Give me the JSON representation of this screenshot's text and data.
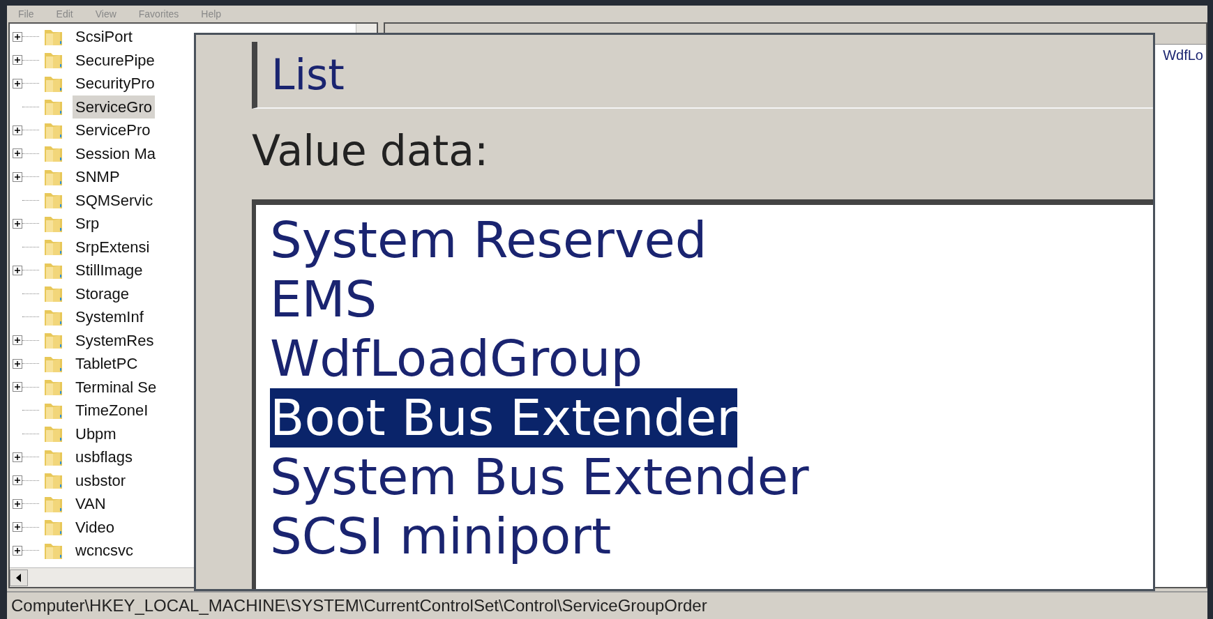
{
  "menu": [
    "File",
    "Edit",
    "View",
    "Favorites",
    "Help"
  ],
  "tree": [
    {
      "label": "ScsiPort",
      "expandable": true,
      "selected": false
    },
    {
      "label": "SecurePipe",
      "expandable": true,
      "selected": false
    },
    {
      "label": "SecurityPro",
      "expandable": true,
      "selected": false
    },
    {
      "label": "ServiceGro",
      "expandable": false,
      "selected": true
    },
    {
      "label": "ServicePro",
      "expandable": true,
      "selected": false
    },
    {
      "label": "Session Ma",
      "expandable": true,
      "selected": false
    },
    {
      "label": "SNMP",
      "expandable": true,
      "selected": false
    },
    {
      "label": "SQMServic",
      "expandable": false,
      "selected": false
    },
    {
      "label": "Srp",
      "expandable": true,
      "selected": false
    },
    {
      "label": "SrpExtensi",
      "expandable": false,
      "selected": false
    },
    {
      "label": "StillImage",
      "expandable": true,
      "selected": false
    },
    {
      "label": "Storage",
      "expandable": false,
      "selected": false
    },
    {
      "label": "SystemInf",
      "expandable": false,
      "selected": false
    },
    {
      "label": "SystemRes",
      "expandable": true,
      "selected": false
    },
    {
      "label": "TabletPC",
      "expandable": true,
      "selected": false
    },
    {
      "label": "Terminal Se",
      "expandable": true,
      "selected": false
    },
    {
      "label": "TimeZoneI",
      "expandable": false,
      "selected": false
    },
    {
      "label": "Ubpm",
      "expandable": false,
      "selected": false
    },
    {
      "label": "usbflags",
      "expandable": true,
      "selected": false
    },
    {
      "label": "usbstor",
      "expandable": true,
      "selected": false
    },
    {
      "label": "VAN",
      "expandable": true,
      "selected": false
    },
    {
      "label": "Video",
      "expandable": true,
      "selected": false
    },
    {
      "label": "wcncsvc",
      "expandable": true,
      "selected": false
    }
  ],
  "values_pane": {
    "rows": [
      {
        "data": "WdfLo"
      }
    ]
  },
  "dialog": {
    "value_name": "List",
    "value_data_label": "Value data:",
    "value_data_lines": [
      {
        "text": "System Reserved",
        "selected": false
      },
      {
        "text": "EMS",
        "selected": false
      },
      {
        "text": "WdfLoadGroup",
        "selected": false
      },
      {
        "text": "Boot Bus Extender",
        "selected": true
      },
      {
        "text": "System Bus Extender",
        "selected": false
      },
      {
        "text": "SCSI miniport",
        "selected": false
      }
    ]
  },
  "status_bar": "Computer\\HKEY_LOCAL_MACHINE\\SYSTEM\\CurrentControlSet\\Control\\ServiceGroupOrder"
}
